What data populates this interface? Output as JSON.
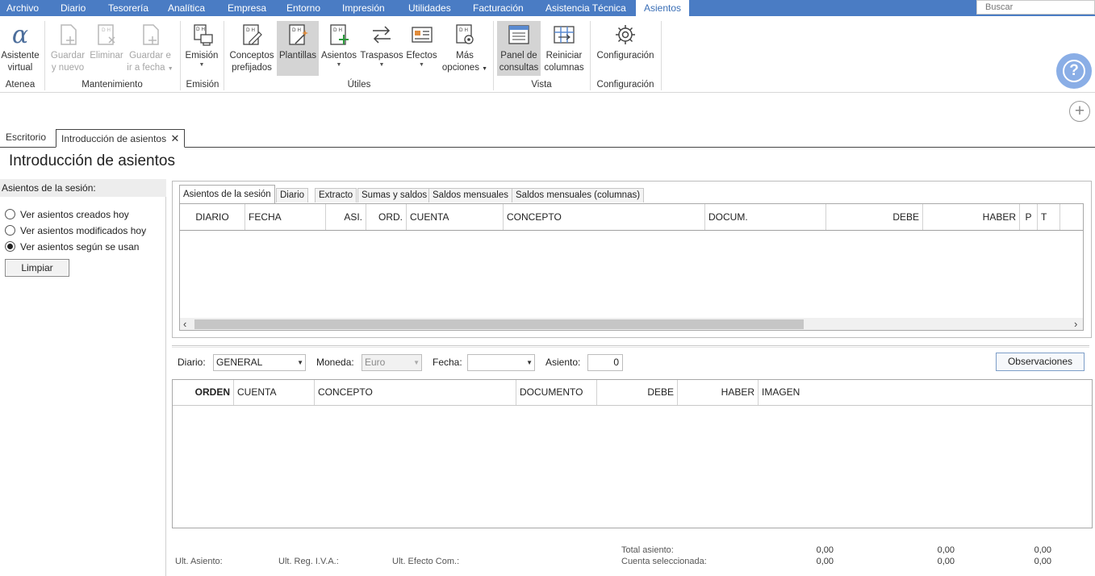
{
  "menu": {
    "items": [
      "Archivo",
      "Diario",
      "Tesorería",
      "Analítica",
      "Empresa",
      "Entorno",
      "Impresión",
      "Utilidades",
      "Facturación",
      "Asistencia Técnica",
      "Asientos"
    ],
    "active": "Asientos",
    "search_placeholder": "Buscar"
  },
  "ribbon": {
    "buttons": {
      "asistente": [
        "Asistente",
        "virtual"
      ],
      "guardar_nuevo": [
        "Guardar",
        "y nuevo"
      ],
      "eliminar": [
        "Eliminar",
        ""
      ],
      "guardar_fecha": [
        "Guardar e",
        "ir a fecha"
      ],
      "emision": [
        "Emisión",
        ""
      ],
      "conceptos": [
        "Conceptos",
        "prefijados"
      ],
      "plantillas": [
        "Plantillas",
        ""
      ],
      "asientos": [
        "Asientos",
        ""
      ],
      "traspasos": [
        "Traspasos",
        ""
      ],
      "efectos": [
        "Efectos",
        ""
      ],
      "mas_opciones": [
        "Más",
        "opciones"
      ],
      "panel_consultas": [
        "Panel de",
        "consultas"
      ],
      "reiniciar_columnas": [
        "Reiniciar",
        "columnas"
      ],
      "configuracion": [
        "Configuración",
        ""
      ]
    },
    "groups": {
      "atenea": "Atenea",
      "mantenimiento": "Mantenimiento",
      "emision": "Emisión",
      "utiles": "Útiles",
      "vista": "Vista",
      "configuracion": "Configuración"
    }
  },
  "doc_tabs": {
    "escritorio": "Escritorio",
    "introduccion": "Introducción de asientos"
  },
  "page_title": "Introducción de asientos",
  "left_panel": {
    "header": "Asientos de la sesión:",
    "options": [
      "Ver asientos creados hoy",
      "Ver asientos modificados hoy",
      "Ver asientos según se usan"
    ],
    "selected_index": 2,
    "clear_button": "Limpiar"
  },
  "upper": {
    "tabs": [
      "Asientos de la sesión",
      "Diario",
      "Extracto",
      "Sumas y saldos",
      "Saldos mensuales",
      "Saldos mensuales (columnas)"
    ],
    "active_tab": 0,
    "columns": [
      "DIARIO",
      "FECHA",
      "ASI.",
      "ORD.",
      "CUENTA",
      "CONCEPTO",
      "DOCUM.",
      "DEBE",
      "HABER",
      "P",
      "T"
    ]
  },
  "form": {
    "diario_label": "Diario:",
    "diario_value": "GENERAL",
    "moneda_label": "Moneda:",
    "moneda_value": "Euro",
    "fecha_label": "Fecha:",
    "fecha_value": "",
    "asiento_label": "Asiento:",
    "asiento_value": "0",
    "observaciones_button": "Observaciones"
  },
  "lower": {
    "columns": [
      "ORDEN",
      "CUENTA",
      "CONCEPTO",
      "DOCUMENTO",
      "DEBE",
      "HABER",
      "IMAGEN"
    ]
  },
  "footer": {
    "ult_asiento": "Ult. Asiento:",
    "ult_reg_iva": "Ult. Reg. I.V.A.:",
    "ult_efecto": "Ult. Efecto Com.:",
    "total_asiento": "Total asiento:",
    "cuenta_seleccionada": "Cuenta seleccionada:",
    "totals": [
      "0,00",
      "0,00",
      "0,00"
    ],
    "selected": [
      "0,00",
      "0,00",
      "0,00"
    ]
  },
  "colors": {
    "menubar": "#4a7cc4",
    "help_circle": "#8aaee6"
  }
}
